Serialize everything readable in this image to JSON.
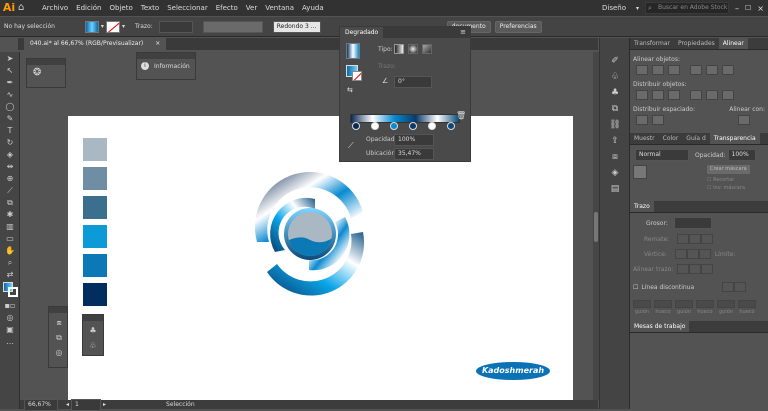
{
  "menubar": {
    "logo": "Ai",
    "items": [
      "Archivo",
      "Edición",
      "Objeto",
      "Texto",
      "Seleccionar",
      "Efecto",
      "Ver",
      "Ventana",
      "Ayuda"
    ],
    "workspace": "Diseño",
    "search_placeholder": "Buscar en Adobe Stock"
  },
  "control": {
    "selection": "No hay selección",
    "stroke_label": "Trazo:",
    "stroke_value": "",
    "brush": "Redondo 3 ...",
    "document_btn": "documento",
    "prefs_btn": "Preferencias"
  },
  "document_tab": {
    "title": "040.ai* al 66,67% (RGB/Previsualizar)",
    "close": "×"
  },
  "info_panel": {
    "label": "Información"
  },
  "gradient_panel": {
    "title": "Degradado",
    "type_label": "Tipo:",
    "trazo_label": "Trazo:",
    "angle": "0°",
    "opacity_label": "Opacidad:",
    "opacity": "100%",
    "location_label": "Ubicación:",
    "location": "35,47%",
    "stops": [
      "#0a2a55",
      "#ffffff",
      "#0a8ad0",
      "#0a3a6a",
      "#ffffff",
      "#0a4a7a"
    ]
  },
  "swatches": [
    "#a9b8c3",
    "#6f8ea3",
    "#3a6f8e",
    "#0c9bd6",
    "#0a79b5",
    "#022d5f"
  ],
  "logo_text": "Kadoshmerah",
  "status": {
    "zoom": "66,67%",
    "page": "1",
    "tool": "Selección"
  },
  "right_panel": {
    "tabs": [
      "Transformar",
      "Propiedades",
      "Alinear"
    ],
    "align_objects": "Alinear objetos:",
    "distribute_objects": "Distribuir objetos:",
    "distribute_spacing": "Distribuir espaciado:",
    "align_to": "Alinear con:",
    "tabs2": [
      "Muestr",
      "Color",
      "Guía d",
      "Transparencia"
    ],
    "blend_mode": "Normal",
    "opacity_label": "Opacidad:",
    "opacity": "100%",
    "make_mask": "Crear máscara",
    "clip": "Recortar",
    "invert": "Inv. máscara",
    "stroke_title": "Trazo",
    "weight_label": "Grosor:",
    "cap_label": "Remate:",
    "corner_label": "Vértice:",
    "limit_label": "Límite:",
    "align_stroke": "Alinear trazo:",
    "dashed_line": "Línea discontinua",
    "dash_labels": [
      "guión",
      "hueco",
      "guión",
      "hueco",
      "guión",
      "hueco"
    ],
    "action_title": "Mesas de trabajo"
  }
}
